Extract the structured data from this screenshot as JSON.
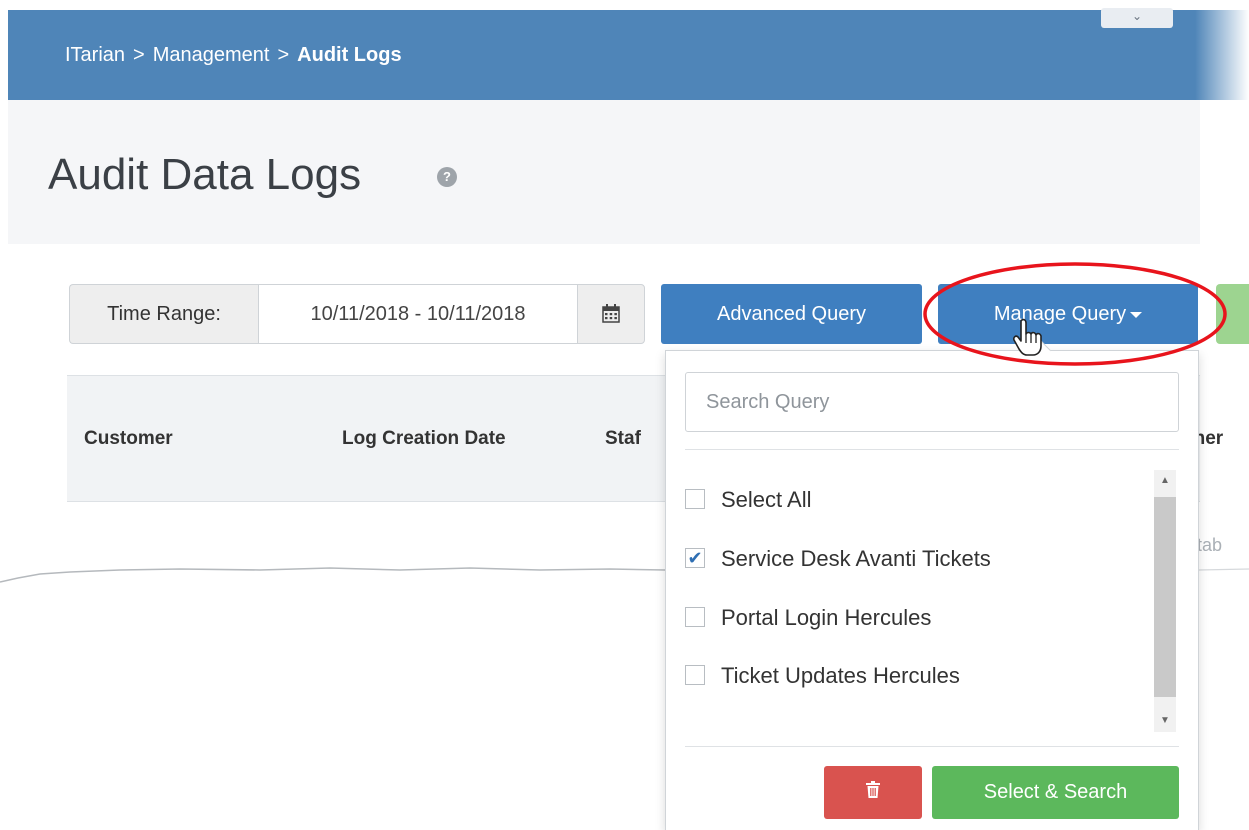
{
  "breadcrumb": {
    "items": [
      "ITarian",
      "Management"
    ],
    "current": "Audit Logs",
    "separator": ">"
  },
  "page": {
    "title": "Audit Data Logs",
    "help_icon": "?"
  },
  "toolbar": {
    "time_range_label": "Time Range:",
    "time_range_value": "10/11/2018 - 10/11/2018",
    "advanced_query_label": "Advanced Query",
    "manage_query_label": "Manage Query"
  },
  "table": {
    "columns": [
      "Customer",
      "Log Creation Date",
      "Staf",
      "oner"
    ],
    "empty_text_fragment": "n tab"
  },
  "manage_query_dropdown": {
    "search_placeholder": "Search Query",
    "items": [
      {
        "label": "Select All",
        "checked": false
      },
      {
        "label": "Service Desk Avanti Tickets",
        "checked": true
      },
      {
        "label": "Portal Login Hercules",
        "checked": false
      },
      {
        "label": "Ticket Updates Hercules",
        "checked": false
      }
    ],
    "select_search_label": "Select & Search"
  },
  "colors": {
    "topbar": "#4f85b8",
    "primary_button": "#3f7fc0",
    "success_button": "#5cb85c",
    "danger_button": "#d9534f",
    "highlight_ellipse": "#e8141c"
  },
  "icons": [
    "help-icon",
    "calendar-icon",
    "caret-down-icon",
    "trash-icon",
    "checkmark-icon",
    "hand-cursor-icon",
    "chevron-down-icon"
  ]
}
